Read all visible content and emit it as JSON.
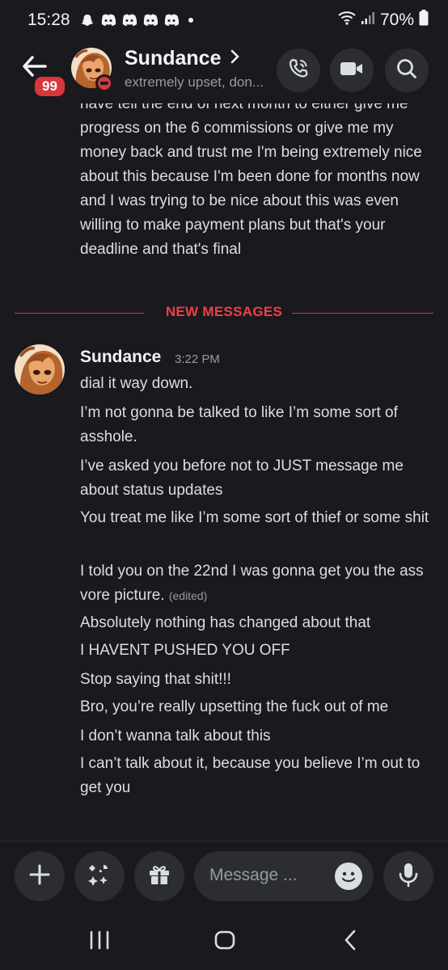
{
  "status_bar": {
    "time": "15:28",
    "battery": "70%"
  },
  "header": {
    "unread_badge": "99",
    "name": "Sundance",
    "status": "extremely upset, don...",
    "icons": [
      "back-arrow-icon",
      "call-icon",
      "video-icon",
      "search-icon"
    ]
  },
  "previous_message": {
    "text": "have tell the end of next month to either give me progress on the 6 commissions or give me my money back and trust me I'm being extremely nice about this because I'm been done for months now and I was trying to be nice about this was even willing to make payment plans but that's your deadline and that's final"
  },
  "divider": {
    "label": "NEW MESSAGES",
    "color": "#f23f43"
  },
  "message_group": {
    "author": "Sundance",
    "time": "3:22 PM",
    "edited_label": "(edited)",
    "lines": [
      "dial it way down.",
      "I’m not gonna be talked to like I’m some sort of asshole.",
      "I’ve asked you before not to JUST message me about status updates",
      "You treat me like I’m some sort of thief or some shit",
      "I told you on the 22nd I was gonna get you the ass vore picture.",
      "Absolutely nothing has changed about that",
      "I HAVENT PUSHED YOU OFF",
      "Stop saying that shit!!!",
      "Bro, you’re really upsetting the fuck out of me",
      "I don’t wanna talk about this",
      "I can’t talk about it, because you believe I’m out to get you"
    ]
  },
  "composer": {
    "placeholder": "Message ...",
    "icons": [
      "plus-icon",
      "apps-icon",
      "gift-icon",
      "emoji-icon",
      "microphone-icon"
    ]
  },
  "nav_bar": {
    "icons": [
      "recent-apps-icon",
      "home-icon",
      "back-icon"
    ]
  },
  "colors": {
    "background": "#1a1a1e",
    "surface": "#2b2d31",
    "text": "#dbdee1",
    "muted": "#949ba4",
    "danger": "#da373c"
  }
}
